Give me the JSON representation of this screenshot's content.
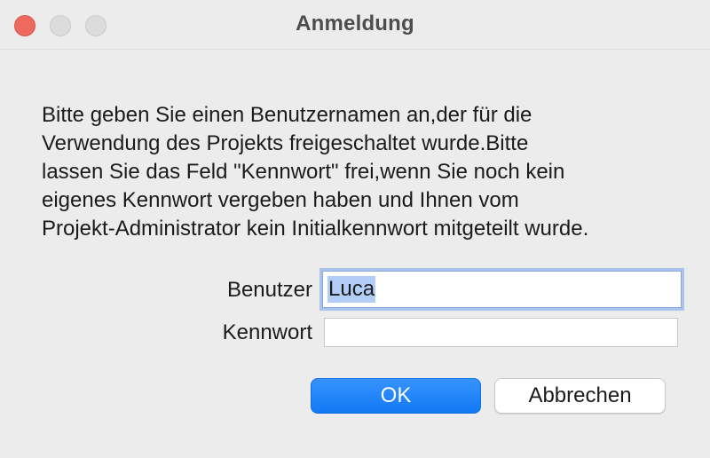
{
  "window": {
    "title": "Anmeldung"
  },
  "message": {
    "lines": [
      "Bitte geben Sie einen Benutzernamen an,der für die",
      "Verwendung des Projekts freigeschaltet wurde.Bitte",
      "lassen Sie das Feld \"Kennwort\" frei,wenn Sie noch kein",
      "eigenes Kennwort vergeben haben und Ihnen vom",
      "Projekt-Administrator kein Initialkennwort mitgeteilt wurde."
    ]
  },
  "form": {
    "user_label": "Benutzer",
    "user_value": "Luca",
    "password_label": "Kennwort",
    "password_value": ""
  },
  "buttons": {
    "ok_label": "OK",
    "cancel_label": "Abbrechen"
  },
  "colors": {
    "accent": "#1a7ff7",
    "close_button": "#ee6a5f",
    "selection": "#b2cdf6"
  }
}
